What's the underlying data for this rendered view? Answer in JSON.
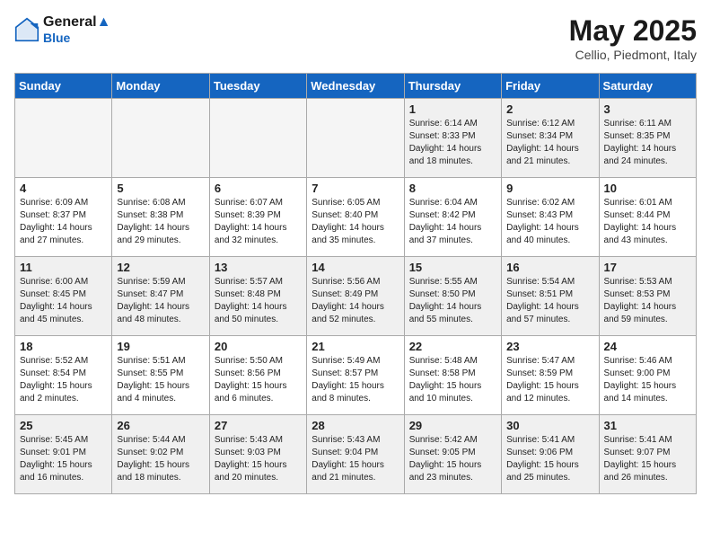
{
  "header": {
    "logo_line1": "General",
    "logo_line2": "Blue",
    "title": "May 2025",
    "subtitle": "Cellio, Piedmont, Italy"
  },
  "weekdays": [
    "Sunday",
    "Monday",
    "Tuesday",
    "Wednesday",
    "Thursday",
    "Friday",
    "Saturday"
  ],
  "weeks": [
    [
      {
        "day": "",
        "info": "",
        "empty": true
      },
      {
        "day": "",
        "info": "",
        "empty": true
      },
      {
        "day": "",
        "info": "",
        "empty": true
      },
      {
        "day": "",
        "info": "",
        "empty": true
      },
      {
        "day": "1",
        "info": "Sunrise: 6:14 AM\nSunset: 8:33 PM\nDaylight: 14 hours\nand 18 minutes.",
        "empty": false
      },
      {
        "day": "2",
        "info": "Sunrise: 6:12 AM\nSunset: 8:34 PM\nDaylight: 14 hours\nand 21 minutes.",
        "empty": false
      },
      {
        "day": "3",
        "info": "Sunrise: 6:11 AM\nSunset: 8:35 PM\nDaylight: 14 hours\nand 24 minutes.",
        "empty": false
      }
    ],
    [
      {
        "day": "4",
        "info": "Sunrise: 6:09 AM\nSunset: 8:37 PM\nDaylight: 14 hours\nand 27 minutes.",
        "empty": false
      },
      {
        "day": "5",
        "info": "Sunrise: 6:08 AM\nSunset: 8:38 PM\nDaylight: 14 hours\nand 29 minutes.",
        "empty": false
      },
      {
        "day": "6",
        "info": "Sunrise: 6:07 AM\nSunset: 8:39 PM\nDaylight: 14 hours\nand 32 minutes.",
        "empty": false
      },
      {
        "day": "7",
        "info": "Sunrise: 6:05 AM\nSunset: 8:40 PM\nDaylight: 14 hours\nand 35 minutes.",
        "empty": false
      },
      {
        "day": "8",
        "info": "Sunrise: 6:04 AM\nSunset: 8:42 PM\nDaylight: 14 hours\nand 37 minutes.",
        "empty": false
      },
      {
        "day": "9",
        "info": "Sunrise: 6:02 AM\nSunset: 8:43 PM\nDaylight: 14 hours\nand 40 minutes.",
        "empty": false
      },
      {
        "day": "10",
        "info": "Sunrise: 6:01 AM\nSunset: 8:44 PM\nDaylight: 14 hours\nand 43 minutes.",
        "empty": false
      }
    ],
    [
      {
        "day": "11",
        "info": "Sunrise: 6:00 AM\nSunset: 8:45 PM\nDaylight: 14 hours\nand 45 minutes.",
        "empty": false
      },
      {
        "day": "12",
        "info": "Sunrise: 5:59 AM\nSunset: 8:47 PM\nDaylight: 14 hours\nand 48 minutes.",
        "empty": false
      },
      {
        "day": "13",
        "info": "Sunrise: 5:57 AM\nSunset: 8:48 PM\nDaylight: 14 hours\nand 50 minutes.",
        "empty": false
      },
      {
        "day": "14",
        "info": "Sunrise: 5:56 AM\nSunset: 8:49 PM\nDaylight: 14 hours\nand 52 minutes.",
        "empty": false
      },
      {
        "day": "15",
        "info": "Sunrise: 5:55 AM\nSunset: 8:50 PM\nDaylight: 14 hours\nand 55 minutes.",
        "empty": false
      },
      {
        "day": "16",
        "info": "Sunrise: 5:54 AM\nSunset: 8:51 PM\nDaylight: 14 hours\nand 57 minutes.",
        "empty": false
      },
      {
        "day": "17",
        "info": "Sunrise: 5:53 AM\nSunset: 8:53 PM\nDaylight: 14 hours\nand 59 minutes.",
        "empty": false
      }
    ],
    [
      {
        "day": "18",
        "info": "Sunrise: 5:52 AM\nSunset: 8:54 PM\nDaylight: 15 hours\nand 2 minutes.",
        "empty": false
      },
      {
        "day": "19",
        "info": "Sunrise: 5:51 AM\nSunset: 8:55 PM\nDaylight: 15 hours\nand 4 minutes.",
        "empty": false
      },
      {
        "day": "20",
        "info": "Sunrise: 5:50 AM\nSunset: 8:56 PM\nDaylight: 15 hours\nand 6 minutes.",
        "empty": false
      },
      {
        "day": "21",
        "info": "Sunrise: 5:49 AM\nSunset: 8:57 PM\nDaylight: 15 hours\nand 8 minutes.",
        "empty": false
      },
      {
        "day": "22",
        "info": "Sunrise: 5:48 AM\nSunset: 8:58 PM\nDaylight: 15 hours\nand 10 minutes.",
        "empty": false
      },
      {
        "day": "23",
        "info": "Sunrise: 5:47 AM\nSunset: 8:59 PM\nDaylight: 15 hours\nand 12 minutes.",
        "empty": false
      },
      {
        "day": "24",
        "info": "Sunrise: 5:46 AM\nSunset: 9:00 PM\nDaylight: 15 hours\nand 14 minutes.",
        "empty": false
      }
    ],
    [
      {
        "day": "25",
        "info": "Sunrise: 5:45 AM\nSunset: 9:01 PM\nDaylight: 15 hours\nand 16 minutes.",
        "empty": false
      },
      {
        "day": "26",
        "info": "Sunrise: 5:44 AM\nSunset: 9:02 PM\nDaylight: 15 hours\nand 18 minutes.",
        "empty": false
      },
      {
        "day": "27",
        "info": "Sunrise: 5:43 AM\nSunset: 9:03 PM\nDaylight: 15 hours\nand 20 minutes.",
        "empty": false
      },
      {
        "day": "28",
        "info": "Sunrise: 5:43 AM\nSunset: 9:04 PM\nDaylight: 15 hours\nand 21 minutes.",
        "empty": false
      },
      {
        "day": "29",
        "info": "Sunrise: 5:42 AM\nSunset: 9:05 PM\nDaylight: 15 hours\nand 23 minutes.",
        "empty": false
      },
      {
        "day": "30",
        "info": "Sunrise: 5:41 AM\nSunset: 9:06 PM\nDaylight: 15 hours\nand 25 minutes.",
        "empty": false
      },
      {
        "day": "31",
        "info": "Sunrise: 5:41 AM\nSunset: 9:07 PM\nDaylight: 15 hours\nand 26 minutes.",
        "empty": false
      }
    ]
  ]
}
